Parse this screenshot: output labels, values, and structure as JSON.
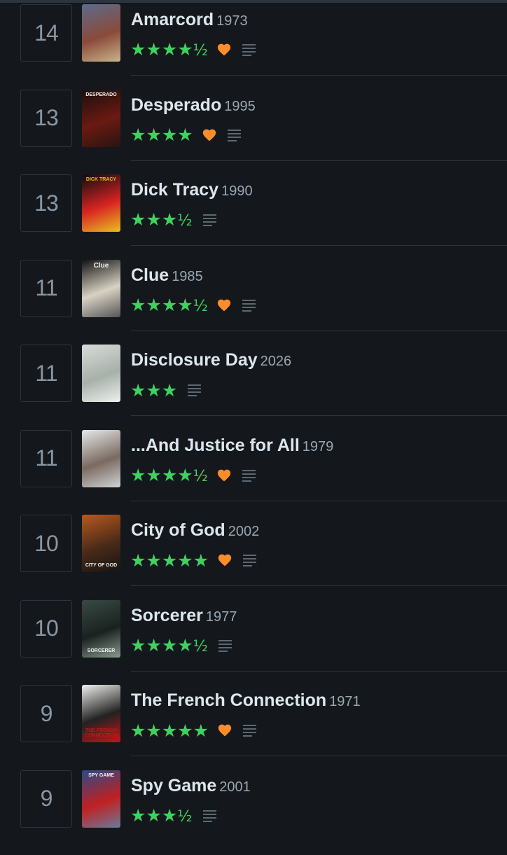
{
  "colors": {
    "background": "#14181c",
    "star": "#40d161",
    "heart": "#ff8c2a",
    "divider": "#2c3440",
    "title": "#dde6ee",
    "year": "#9aa6b2"
  },
  "films": [
    {
      "rank": "14",
      "title": "Amarcord",
      "year": "1973",
      "stars": "★★★★",
      "half": "½",
      "liked": true,
      "review_icon": "review-lines-icon",
      "poster": {
        "caption": "",
        "colors": [
          "#5b6b8c",
          "#8a4a3a",
          "#c9b48a"
        ]
      }
    },
    {
      "rank": "13",
      "title": "Desperado",
      "year": "1995",
      "stars": "★★★★",
      "half": "",
      "liked": true,
      "review_icon": "review-lines-icon",
      "poster": {
        "caption": "DESPERADO",
        "colors": [
          "#1a0f0c",
          "#6a1a12",
          "#2a1410"
        ]
      }
    },
    {
      "rank": "13",
      "title": "Dick Tracy",
      "year": "1990",
      "stars": "★★★",
      "half": "½",
      "liked": false,
      "review_icon": "review-lines-icon",
      "poster": {
        "caption": "DICK TRACY",
        "colors": [
          "#0d0d0d",
          "#d82323",
          "#e8c020"
        ]
      }
    },
    {
      "rank": "11",
      "title": "Clue",
      "year": "1985",
      "stars": "★★★★",
      "half": "½",
      "liked": true,
      "review_icon": "review-lines-icon",
      "poster": {
        "caption": "Clue",
        "colors": [
          "#111111",
          "#d8d2c4",
          "#555555"
        ]
      }
    },
    {
      "rank": "11",
      "title": "Disclosure Day",
      "year": "2026",
      "stars": "★★★",
      "half": "",
      "liked": false,
      "review_icon": "review-lines-icon",
      "poster": {
        "caption": "",
        "colors": [
          "#d8dcd8",
          "#a8b0aa",
          "#eef0ee"
        ]
      }
    },
    {
      "rank": "11",
      "title": "...And Justice for All",
      "year": "1979",
      "stars": "★★★★",
      "half": "½",
      "liked": true,
      "review_icon": "review-lines-icon",
      "poster": {
        "caption": "",
        "colors": [
          "#e6e8ea",
          "#7a6a60",
          "#cfd3d6"
        ]
      }
    },
    {
      "rank": "10",
      "title": "City of God",
      "year": "2002",
      "stars": "★★★★★",
      "half": "",
      "liked": true,
      "review_icon": "review-lines-icon",
      "poster": {
        "caption": "CITY OF GOD",
        "colors": [
          "#b85a1e",
          "#4a2a18",
          "#141414"
        ]
      }
    },
    {
      "rank": "10",
      "title": "Sorcerer",
      "year": "1977",
      "stars": "★★★★",
      "half": "½",
      "liked": false,
      "review_icon": "review-lines-icon",
      "poster": {
        "caption": "SORCERER",
        "colors": [
          "#3a4a44",
          "#1a2220",
          "#8a9a8e"
        ]
      }
    },
    {
      "rank": "9",
      "title": "The French Connection",
      "year": "1971",
      "stars": "★★★★★",
      "half": "",
      "liked": true,
      "review_icon": "review-lines-icon",
      "poster": {
        "caption": "THE FRENCH CONNECTION",
        "colors": [
          "#f0f0ee",
          "#222222",
          "#c01818"
        ]
      }
    },
    {
      "rank": "9",
      "title": "Spy Game",
      "year": "2001",
      "stars": "★★★",
      "half": "½",
      "liked": false,
      "review_icon": "review-lines-icon",
      "poster": {
        "caption": "SPY GAME",
        "colors": [
          "#2a4a8a",
          "#c02020",
          "#6a7a9a"
        ]
      }
    }
  ]
}
